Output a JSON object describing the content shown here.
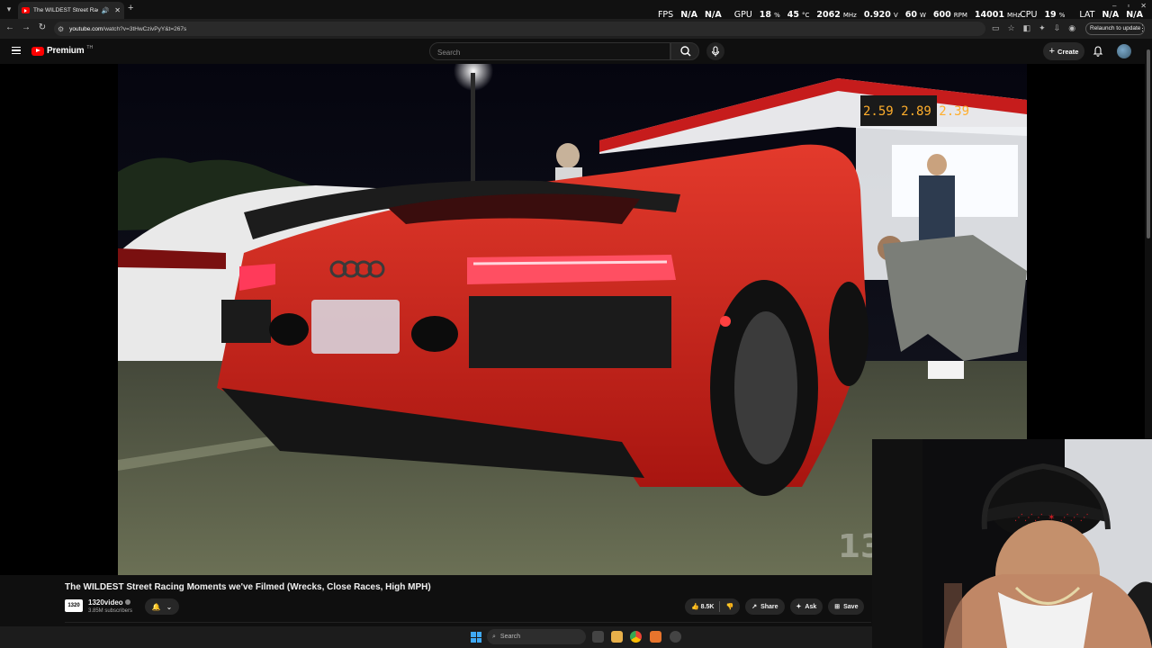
{
  "browser": {
    "tab_title": "The WILDEST Street Racing",
    "url_domain": "youtube.com",
    "url_path": "/watch?v=3tHwCzivPyY&t=267s",
    "relaunch_label": "Relaunch to update"
  },
  "perf_overlay": {
    "fps_label": "FPS",
    "fps_value": "N/A",
    "fps_value2": "N/A",
    "gpu_label": "GPU",
    "gpu_load": "18",
    "gpu_load_unit": "%",
    "gpu_temp": "45",
    "gpu_temp_unit": "°C",
    "gpu_clock": "2062",
    "gpu_clock_unit": "MHz",
    "gpu_voltage": "0.920",
    "gpu_voltage_unit": "V",
    "gpu_power": "60",
    "gpu_power_unit": "W",
    "gpu_fan": "600",
    "gpu_fan_unit": "RPM",
    "mem_clock": "14001",
    "mem_clock_unit": "MHz",
    "cpu_label": "CPU",
    "cpu_load": "19",
    "cpu_load_unit": "%",
    "lat_label": "LAT",
    "lat_value": "N/A",
    "lat_value2": "N/A"
  },
  "masthead": {
    "logo_text": "Premium",
    "region": "TH",
    "search_placeholder": "Search",
    "create_label": "Create"
  },
  "video": {
    "title": "The WILDEST Street Racing Moments we've Filmed (Wrecks, Close Races, High MPH)",
    "gas_prices": "2.59  2.89  2.39",
    "watermark": "13"
  },
  "channel": {
    "avatar_text": "1320",
    "name": "1320video",
    "subscribers": "3.85M subscribers"
  },
  "actions": {
    "likes": "8.5K",
    "share": "Share",
    "ask": "Ask",
    "save": "Save"
  },
  "taskbar": {
    "search_placeholder": "Search"
  },
  "colors": {
    "youtube_red": "#ff0000",
    "car_red": "#d9261c",
    "background": "#0f0f0f"
  }
}
